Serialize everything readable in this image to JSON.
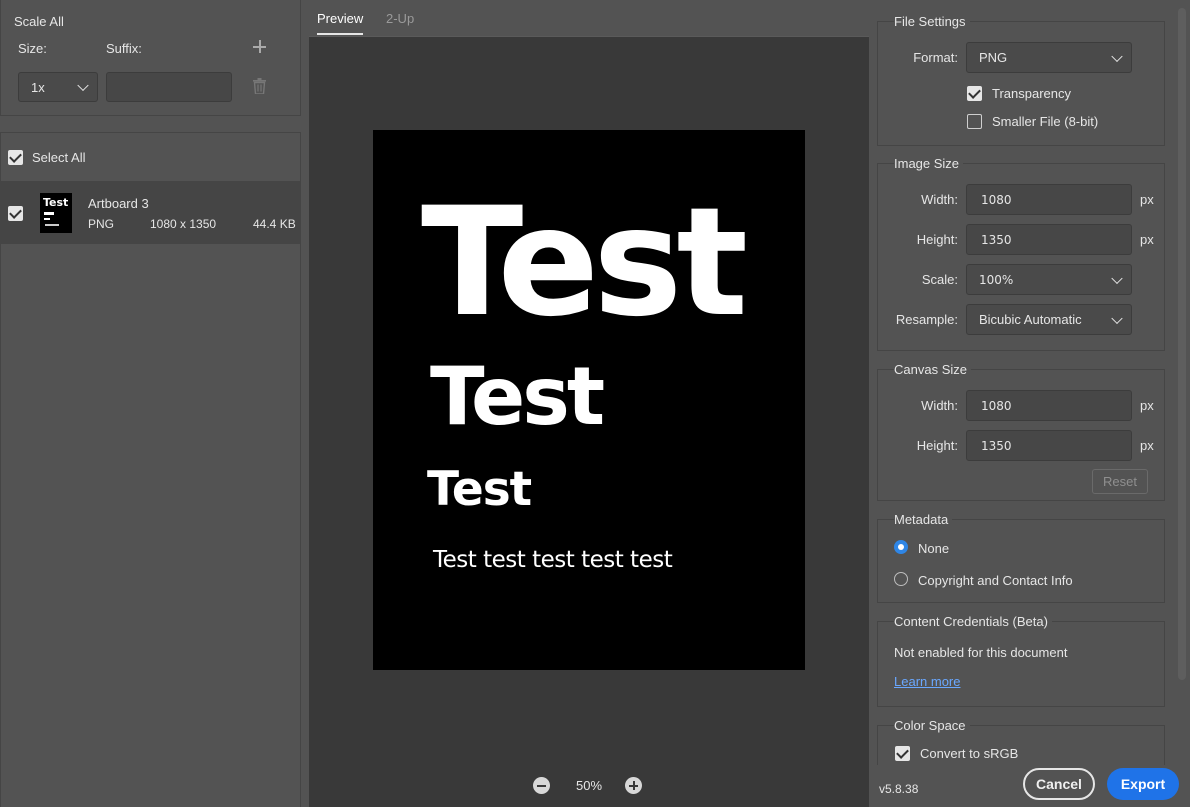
{
  "left": {
    "scale_all_title": "Scale All",
    "size_label": "Size:",
    "suffix_label": "Suffix:",
    "size_value": "1x",
    "suffix_value": "",
    "select_all_label": "Select All",
    "item": {
      "name": "Artboard 3",
      "format": "PNG",
      "dimensions": "1080 x 1350",
      "filesize": "44.4 KB",
      "thumb_text": "Test"
    }
  },
  "center": {
    "tabs": [
      "Preview",
      "2-Up"
    ],
    "canvas_texts": [
      "Test",
      "Test",
      "Test",
      "Test test test test test"
    ],
    "zoom": "50%"
  },
  "right": {
    "file_settings": {
      "title": "File Settings",
      "format_label": "Format:",
      "format_value": "PNG",
      "transparency_label": "Transparency",
      "smaller_file_label": "Smaller File (8-bit)"
    },
    "image_size": {
      "title": "Image Size",
      "width_label": "Width:",
      "width_value": "1080",
      "height_label": "Height:",
      "height_value": "1350",
      "scale_label": "Scale:",
      "scale_value": "100%",
      "resample_label": "Resample:",
      "resample_value": "Bicubic Automatic",
      "unit": "px"
    },
    "canvas_size": {
      "title": "Canvas Size",
      "width_label": "Width:",
      "width_value": "1080",
      "height_label": "Height:",
      "height_value": "1350",
      "reset_label": "Reset",
      "unit": "px"
    },
    "metadata": {
      "title": "Metadata",
      "none_label": "None",
      "copyright_label": "Copyright and Contact Info"
    },
    "content_credentials": {
      "title": "Content Credentials (Beta)",
      "status": "Not enabled for this document",
      "learn_more": "Learn more"
    },
    "color_space": {
      "title": "Color Space",
      "convert_label": "Convert to sRGB"
    }
  },
  "footer": {
    "version": "v5.8.38",
    "cancel_label": "Cancel",
    "export_label": "Export"
  },
  "colors": {
    "accent": "#1f73e8",
    "panel_bg": "#535353",
    "preview_bg": "#393939"
  }
}
